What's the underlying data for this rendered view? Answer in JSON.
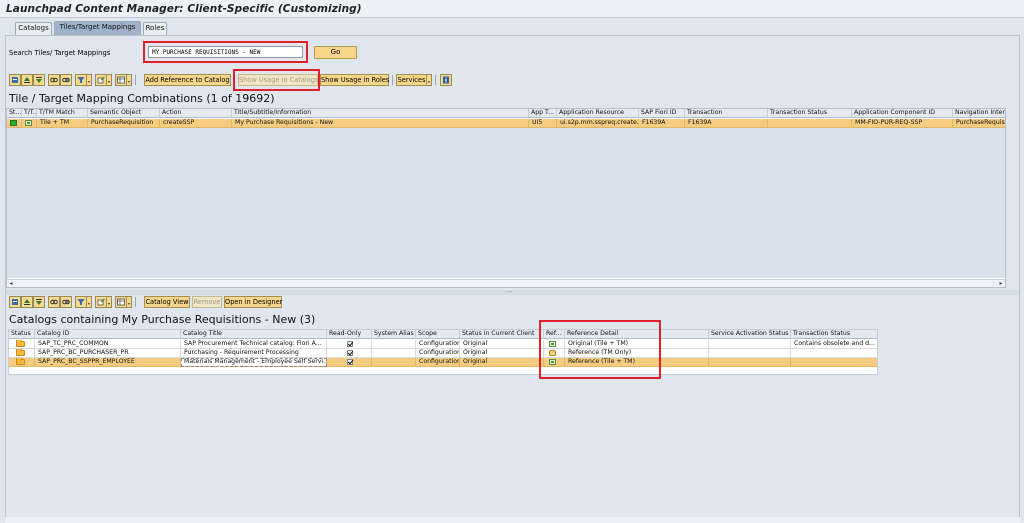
{
  "window": {
    "title": "Launchpad Content Manager: Client-Specific (Customizing)"
  },
  "tabs": [
    {
      "label": "Catalogs",
      "active": false
    },
    {
      "label": "Tiles/Target Mappings",
      "active": true
    },
    {
      "label": "Roles",
      "active": false
    }
  ],
  "search": {
    "label": "Search Tiles/ Target Mappings",
    "value": "MY PURCHASE REQUISITIONS - NEW",
    "go_label": "Go"
  },
  "top_toolbar": {
    "add_reference_label": "Add Reference to Catalog",
    "show_usage_catalogs_label": "Show Usage in Catalogs",
    "show_usage_roles_label": "Show Usage in Roles",
    "services_label": "Services"
  },
  "top_grid": {
    "title": "Tile / Target Mapping Combinations (1 of 19692)",
    "columns": [
      "St...",
      "T/T...",
      "T/TM Match",
      "Semantic Object",
      "Action",
      "Title/Subtitle/Information",
      "App T...",
      "Application Resource",
      "SAP Fiori ID",
      "Transaction",
      "Transaction Status",
      "Application Component ID",
      "Navigation Inten"
    ],
    "rows": [
      {
        "match": "Tile + TM",
        "semantic_object": "PurchaseRequisition",
        "action": "createSSP",
        "title": "My Purchase Requisitions - New",
        "app_type": "UI5",
        "app_resource": "ui.s2p.mm.sspreq.create...",
        "fiori_id": "F1639A",
        "transaction": "F1639A",
        "transaction_status": "",
        "component_id": "MM-FIO-PUR-REQ-SSP",
        "nav_intent": "PurchaseRequisit"
      }
    ]
  },
  "bottom_toolbar": {
    "catalog_view_label": "Catalog View",
    "remove_label": "Remove",
    "open_designer_label": "Open in Designer"
  },
  "bottom_grid": {
    "title": "Catalogs containing My Purchase Requisitions - New (3)",
    "columns": [
      "Status",
      "Catalog ID",
      "Catalog Title",
      "Read-Only",
      "System Alias",
      "Scope",
      "Status in Current Client",
      "Ref...",
      "Reference Detail",
      "Service Activation Status",
      "Transaction Status"
    ],
    "rows": [
      {
        "catalog_id": "SAP_TC_PRC_COMMON",
        "catalog_title": "SAP Procurement Technical catalog: Fiori A...",
        "scope": "Configuration",
        "status_client": "Original",
        "ref_type": "tile",
        "reference_detail": "Original (Tile + TM)",
        "transaction_status": "Contains obsolete and d..."
      },
      {
        "catalog_id": "SAP_PRC_BC_PURCHASER_PR",
        "catalog_title": "Purchasing - Requirement Processing",
        "scope": "Configuration",
        "status_client": "Original",
        "ref_type": "tm",
        "reference_detail": "Reference (TM Only)",
        "transaction_status": ""
      },
      {
        "catalog_id": "SAP_PRC_BC_SSPPR_EMPLOYEE",
        "catalog_title": "Materials Management - Employee Self Servi...",
        "scope": "Configuration",
        "status_client": "Original",
        "ref_type": "tile",
        "reference_detail": "Reference (Tile + TM)",
        "transaction_status": ""
      }
    ]
  },
  "colors": {
    "accent_selection": "#f6cd80",
    "button": "#f7d58a",
    "highlight": "#e0202a"
  }
}
